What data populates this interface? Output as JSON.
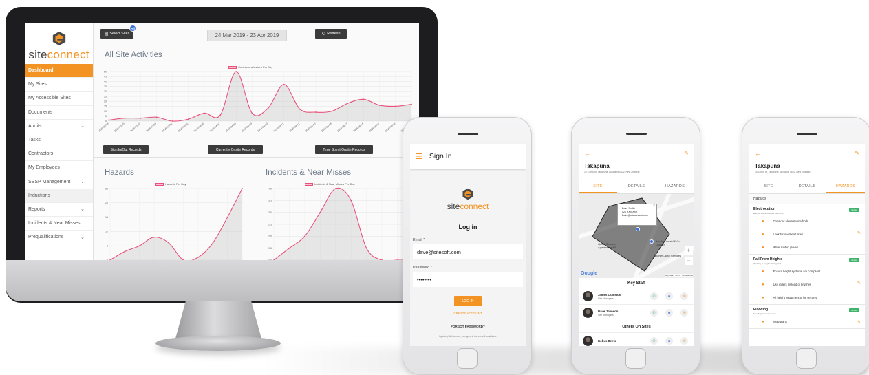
{
  "brand": {
    "name_part1": "site",
    "name_part2": "connect",
    "accent": "#f39323"
  },
  "desktop": {
    "sidebar": [
      {
        "label": "Dashboard",
        "active": true,
        "chevron": false
      },
      {
        "label": "My Sites",
        "chevron": false
      },
      {
        "label": "My Accessible Sites",
        "chevron": false
      },
      {
        "label": "Documents",
        "chevron": false
      },
      {
        "label": "Audits",
        "chevron": true
      },
      {
        "label": "Tasks",
        "chevron": false
      },
      {
        "label": "Contractors",
        "chevron": false
      },
      {
        "label": "My Employees",
        "chevron": false
      },
      {
        "label": "SSSP Management",
        "chevron": true
      },
      {
        "label": "Inductions",
        "chevron": false
      },
      {
        "label": "Reports",
        "chevron": true
      },
      {
        "label": "Incidents & Near Misses",
        "chevron": false
      },
      {
        "label": "Prequalifications",
        "chevron": true
      }
    ],
    "toolbar": {
      "select_sites": "Select Sites",
      "select_badge": "All",
      "date_range": "24 Mar 2019 - 23 Apr 2019",
      "refresh": "Refresh"
    },
    "activities_title": "All Site Activities",
    "records_buttons": [
      "Sign In/Out Records",
      "Currently Onsite Records",
      "Time Spent Onsite Records"
    ],
    "hazards_title": "Hazards",
    "incidents_title": "Incidents & Near Misses"
  },
  "chart_data": [
    {
      "type": "area",
      "title": "",
      "legend": "Contractors/Visitors Per Day",
      "categories": [
        "2019-03-24",
        "2019-03-25",
        "2019-03-26",
        "2019-03-29",
        "2019-03-31",
        "2019-04-01",
        "2019-04-06",
        "2019-04-07",
        "2019-04-08",
        "2019-04-09",
        "2019-04-10",
        "2019-04-11",
        "2019-04-12",
        "2019-04-13",
        "2019-04-14",
        "2019-04-15",
        "2019-04-16",
        "2019-04-17",
        "2019-04-18",
        "2019-04-19"
      ],
      "values": [
        1,
        3,
        3,
        4,
        0,
        2,
        8,
        6,
        50,
        8,
        13,
        37,
        12,
        9,
        10,
        18,
        22,
        16,
        15,
        17
      ],
      "ylim": [
        0,
        50
      ],
      "yticks": [
        0,
        5,
        10,
        15,
        20,
        25,
        30,
        35,
        40,
        45,
        50
      ]
    },
    {
      "type": "area",
      "title": "",
      "legend": "Hazards Per Day",
      "values": [
        0,
        3,
        5,
        8,
        6,
        0,
        1,
        6,
        15,
        25
      ],
      "ylim": [
        0,
        25
      ],
      "yticks": [
        0,
        5,
        10,
        15,
        20,
        25
      ]
    },
    {
      "type": "area",
      "title": "",
      "legend": "Incidents & Near Misses Per Day",
      "values": [
        1.0,
        1.5,
        2.0,
        3.0,
        4.0,
        3.5,
        1.5,
        1.0,
        1.0,
        1.0
      ],
      "ylim": [
        1.0,
        4.0
      ],
      "yticks": [
        "1.0",
        "1.5",
        "2.0",
        "2.5",
        "3.0",
        "3.5",
        "4.0"
      ]
    }
  ],
  "login_phone": {
    "header_title": "Sign In",
    "heading": "Log in",
    "email_label": "Email *",
    "email_value": "dave@sitesoft.com",
    "password_label": "Password *",
    "password_value": "••••••••",
    "login_button": "LOG IN",
    "create_account": "CREATE ACCOUNT",
    "forgot_password": "FORGOT PASSWORD?",
    "terms": "By using SiteConnect, you agree to the terms & conditions."
  },
  "site_phone": {
    "site_name": "Takapuna",
    "address": "10 Como St, Takapuna, Auckland 0622, New Zealand",
    "tabs": [
      "SITE",
      "DETAILS",
      "HAZARDS"
    ],
    "map_popup": [
      "Dave Smith",
      "021 XXX XXX",
      "Dave@siteconnect.com"
    ],
    "map_labels": [
      "Quest Services Apartments NZ",
      "Jon McDonald & Co - Lawyer",
      "Michies Auto Services"
    ],
    "map_google": "Google",
    "map_footer": [
      "Map Data",
      "10 m",
      "Terms of Use"
    ],
    "key_staff_title": "Key Staff",
    "key_staff": [
      {
        "name": "James Cranston",
        "role": "Site Managers"
      },
      {
        "name": "Dave Johnson",
        "role": "Site Managers"
      }
    ],
    "others_title": "Others On Sites",
    "others": [
      {
        "name": "Kobus Beets"
      }
    ]
  },
  "hazards_phone": {
    "site_name": "Takapuna",
    "address": "10 Como St, Takapuna, Auckland 0622, New Zealand",
    "tabs": [
      "SITE",
      "DETAILS",
      "HAZARDS"
    ],
    "list_title": "Hazards",
    "groups": [
      {
        "title": "Electrocution",
        "subtitle": "Electric shock from the machinery",
        "tag": "Verified",
        "items": [
          "Consider alternate methods",
          "Look for overhead lines",
          "Wear rubber gloves"
        ]
      },
      {
        "title": "Fall From Heights",
        "subtitle": "Working at heights during task",
        "tag": "Verified",
        "items": [
          "Ensure height systems are compliant",
          "Use rollers instead of brushes",
          "All height equipment to be secured"
        ]
      },
      {
        "title": "Flooding",
        "subtitle": "Flooding from water tank",
        "tag": "Verified",
        "items": [
          "View plans"
        ]
      }
    ]
  }
}
